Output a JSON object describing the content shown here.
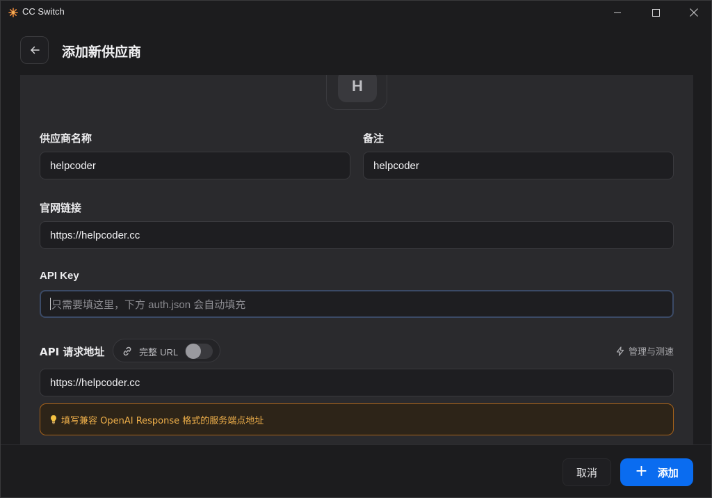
{
  "window": {
    "title": "CC Switch",
    "app_icon": "sunburst-icon"
  },
  "header": {
    "back_icon": "arrow-left-icon",
    "title": "添加新供应商"
  },
  "form": {
    "avatar_letter": "H",
    "provider_name": {
      "label": "供应商名称",
      "value": "helpcoder"
    },
    "note": {
      "label": "备注",
      "value": "helpcoder"
    },
    "website": {
      "label": "官网链接",
      "value": "https://helpcoder.cc"
    },
    "api_key": {
      "label": "API Key",
      "value": "",
      "placeholder": "只需要填这里，下方 auth.json 会自动填充"
    },
    "endpoint": {
      "label": "API 请求地址",
      "full_url_toggle_label_cjk": "完整",
      "full_url_toggle_label_latin": "URL",
      "full_url_enabled": false,
      "manage_link": "管理与测速",
      "value": "https://helpcoder.cc",
      "hint": "填写兼容 OpenAI Response 格式的服务端点地址"
    }
  },
  "footer": {
    "cancel_label": "取消",
    "add_label": "添加"
  },
  "colors": {
    "accent": "#0a6cf0",
    "warning": "#f0b04a",
    "warning_border": "#a6621a"
  }
}
